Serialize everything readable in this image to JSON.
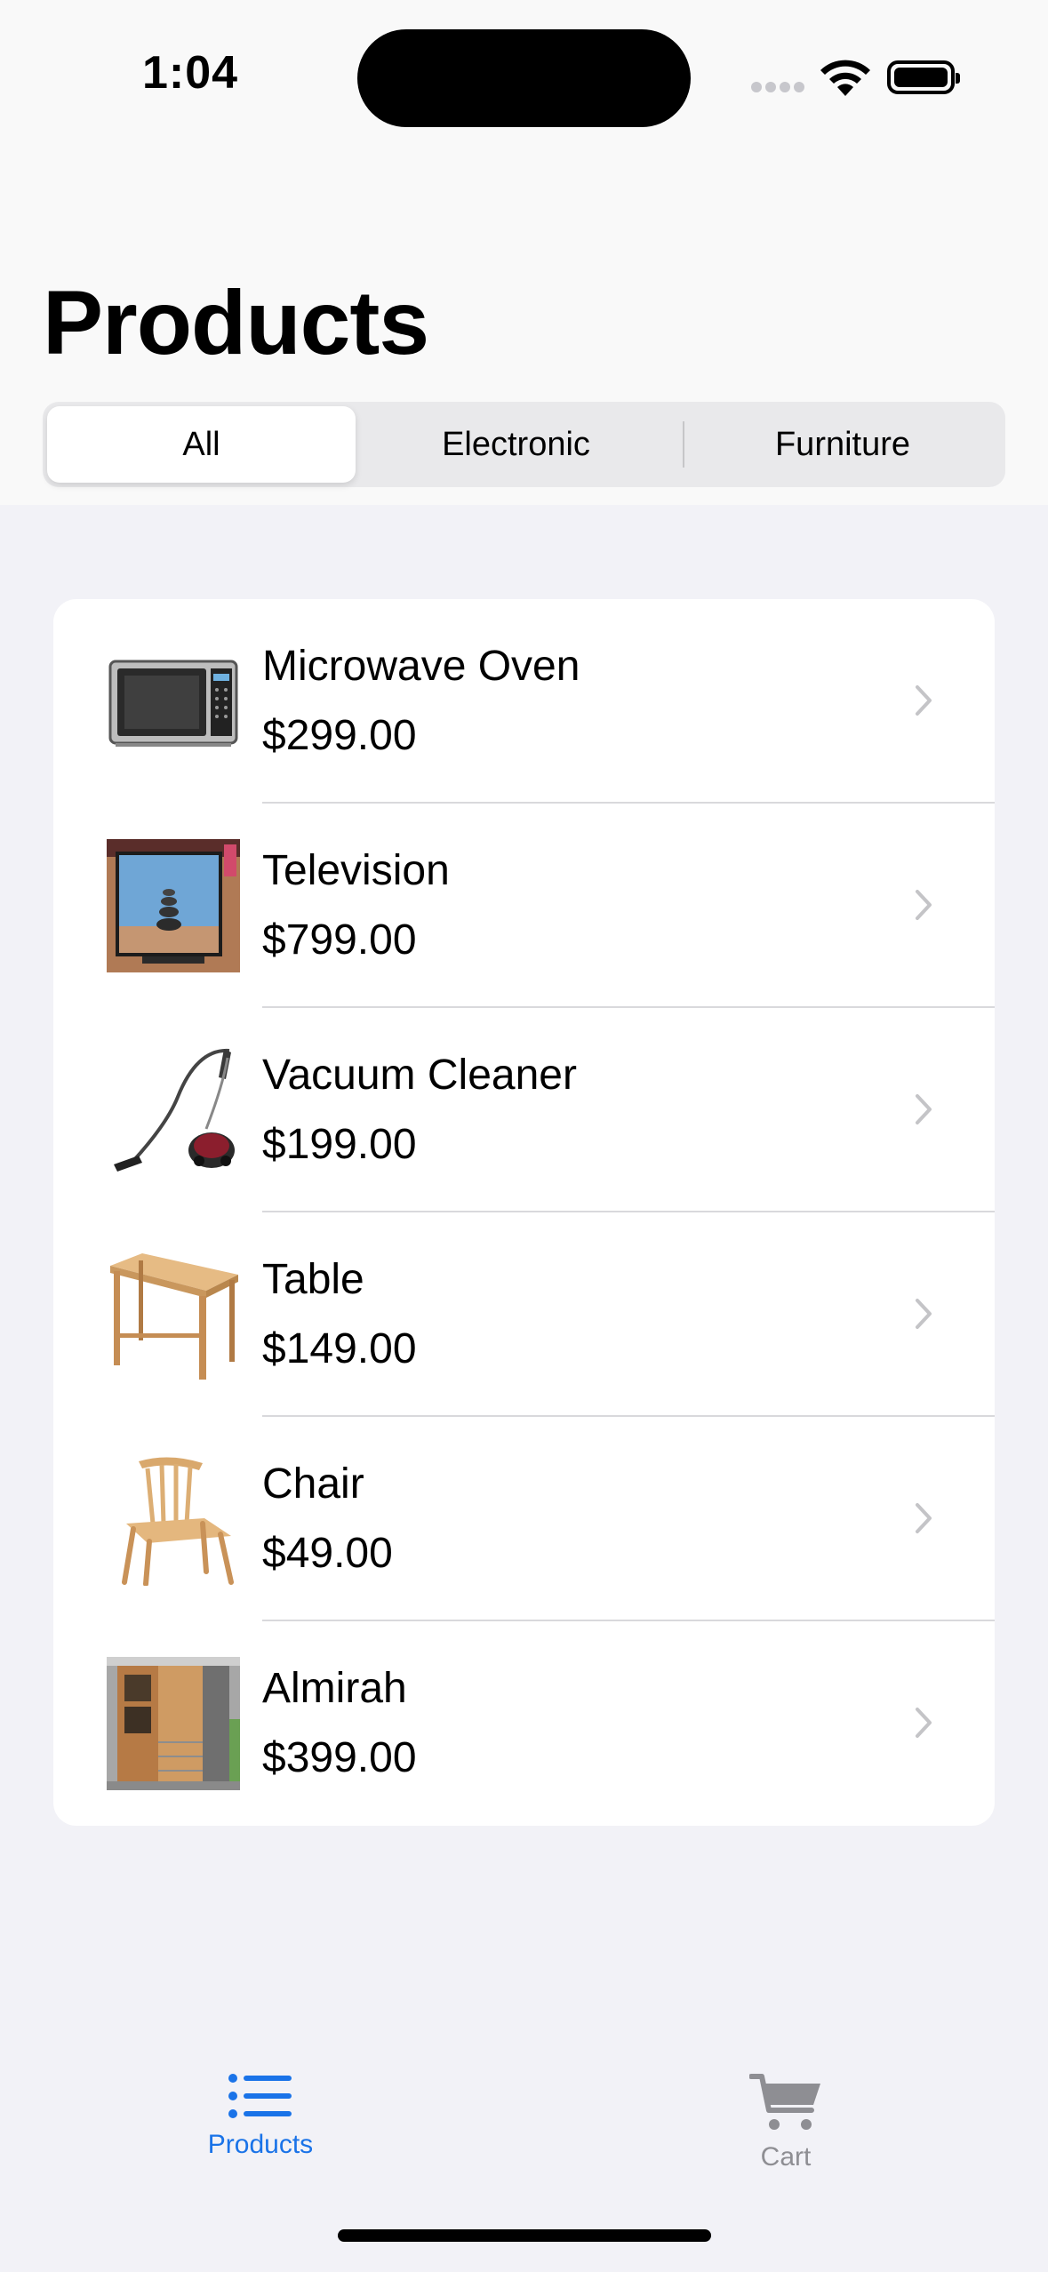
{
  "status_bar": {
    "time": "1:04"
  },
  "nav": {
    "title": "Products"
  },
  "filter": {
    "segments": [
      "All",
      "Electronic",
      "Furniture"
    ],
    "selected": "All"
  },
  "products": [
    {
      "name": "Microwave Oven",
      "price": "$299.00",
      "icon": "microwave-image"
    },
    {
      "name": "Television",
      "price": "$799.00",
      "icon": "television-image"
    },
    {
      "name": "Vacuum Cleaner",
      "price": "$199.00",
      "icon": "vacuum-cleaner-image"
    },
    {
      "name": "Table",
      "price": "$149.00",
      "icon": "table-image"
    },
    {
      "name": "Chair",
      "price": "$49.00",
      "icon": "chair-image"
    },
    {
      "name": "Almirah",
      "price": "$399.00",
      "icon": "almirah-image"
    }
  ],
  "tabbar": {
    "tabs": [
      {
        "label": "Products",
        "icon": "list-icon",
        "active": true
      },
      {
        "label": "Cart",
        "icon": "cart-icon",
        "active": false
      }
    ]
  },
  "colors": {
    "accent": "#1a73e8",
    "inactive": "#8e8e93",
    "background": "#f2f2f7"
  }
}
